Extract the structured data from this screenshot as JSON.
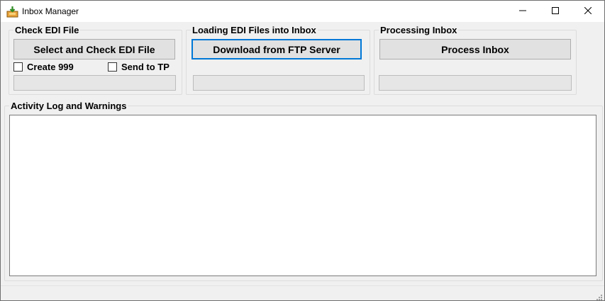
{
  "window": {
    "title": "Inbox Manager"
  },
  "groups": {
    "check_edi": {
      "legend": "Check EDI File",
      "button_label": "Select and Check EDI File",
      "create_999_label": "Create 999",
      "create_999_checked": false,
      "send_to_tp_label": "Send to TP",
      "send_to_tp_checked": false,
      "progress": 0
    },
    "loading": {
      "legend": "Loading EDI Files into Inbox",
      "button_label": "Download from FTP Server",
      "progress": 0
    },
    "processing": {
      "legend": "Processing Inbox",
      "button_label": "Process Inbox",
      "progress": 0
    },
    "activity": {
      "legend": "Activity Log and Warnings",
      "log_text": ""
    }
  },
  "icons": {
    "app": "inbox-tray-icon",
    "minimize": "minimize-icon",
    "maximize": "maximize-icon",
    "close": "close-icon",
    "resize": "resize-grip-icon"
  },
  "colors": {
    "focus_border": "#0078d7",
    "button_bg": "#e1e1e1",
    "window_bg": "#f0f0f0"
  }
}
